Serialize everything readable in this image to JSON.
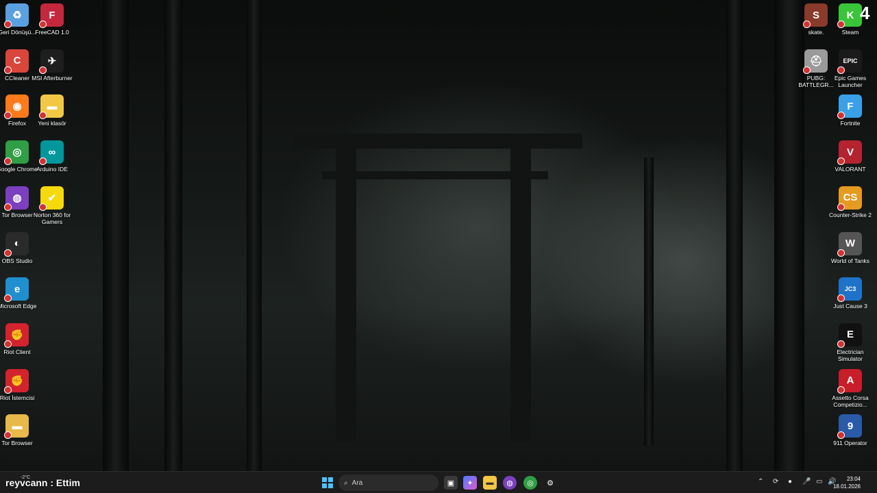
{
  "desktop": {
    "left_col1": [
      {
        "label": "Geri Dönüşü...",
        "icon": "recycle-bin-icon",
        "color": "#5aa0e0",
        "glyph": "♻"
      },
      {
        "label": "CCleaner",
        "icon": "ccleaner-icon",
        "color": "#d9463b",
        "glyph": "C"
      },
      {
        "label": "Firefox",
        "icon": "firefox-icon",
        "color": "#ff7a1a",
        "glyph": "◉"
      },
      {
        "label": "Google Chrome",
        "icon": "chrome-icon",
        "color": "#2f9e44",
        "glyph": "◎"
      },
      {
        "label": "Tor Browser",
        "icon": "tor-icon",
        "color": "#7b3fbf",
        "glyph": "◍"
      },
      {
        "label": "OBS Studio",
        "icon": "obs-icon",
        "color": "#2a2a2a",
        "glyph": "◐"
      },
      {
        "label": "Microsoft Edge",
        "icon": "edge-icon",
        "color": "#1f8fd0",
        "glyph": "e"
      },
      {
        "label": "Riot Client",
        "icon": "riot-client-icon",
        "color": "#d3232e",
        "glyph": "✊"
      },
      {
        "label": "Riot İstemcisi",
        "icon": "riot-client-icon",
        "color": "#d3232e",
        "glyph": "✊"
      },
      {
        "label": "Tor Browser",
        "icon": "folder-icon",
        "color": "#e7b84a",
        "glyph": "▬"
      }
    ],
    "left_col2": [
      {
        "label": "FreeCAD 1.0",
        "icon": "freecad-icon",
        "color": "#c5283d",
        "glyph": "F"
      },
      {
        "label": "MSI Afterburner",
        "icon": "msi-afterburner-icon",
        "color": "#1e1e1e",
        "glyph": "✈"
      },
      {
        "label": "Yeni klasör",
        "icon": "folder-icon",
        "color": "#f2c744",
        "glyph": "▬"
      },
      {
        "label": "Arduino IDE",
        "icon": "arduino-icon",
        "color": "#00979d",
        "glyph": "∞"
      },
      {
        "label": "Norton 360 for Gamers",
        "icon": "norton-icon",
        "color": "#f5d90a",
        "glyph": "✔"
      }
    ],
    "right_col1": [
      {
        "label": "skate.",
        "icon": "skate-icon",
        "color": "#8a3a2a",
        "glyph": "S"
      },
      {
        "label": "PUBG: BATTLEGR...",
        "icon": "pubg-icon",
        "color": "#9a9a9a",
        "glyph": "⛑"
      }
    ],
    "right_col2": [
      {
        "label": "Steam",
        "icon": "steam-icon",
        "color": "#3ac43a",
        "glyph": "K"
      },
      {
        "label": "Epic Games Launcher",
        "icon": "epic-games-icon",
        "color": "#1a1a1a",
        "glyph": "EPIC"
      },
      {
        "label": "Fortnite",
        "icon": "fortnite-icon",
        "color": "#3aa0e8",
        "glyph": "F"
      },
      {
        "label": "VALORANT",
        "icon": "valorant-icon",
        "color": "#b5232f",
        "glyph": "V"
      },
      {
        "label": "Counter-Strike 2",
        "icon": "counter-strike-icon",
        "color": "#e69a1f",
        "glyph": "CS"
      },
      {
        "label": "World of Tanks",
        "icon": "world-of-tanks-icon",
        "color": "#555",
        "glyph": "W"
      },
      {
        "label": "Just Cause 3",
        "icon": "just-cause-icon",
        "color": "#1e73c8",
        "glyph": "JC3"
      },
      {
        "label": "Electrician Simulator",
        "icon": "electrician-simulator-icon",
        "color": "#111",
        "glyph": "E"
      },
      {
        "label": "Assetto Corsa Competizio...",
        "icon": "assetto-corsa-icon",
        "color": "#c81e2a",
        "glyph": "A"
      },
      {
        "label": "911 Operator",
        "icon": "911-operator-icon",
        "color": "#2a5aa8",
        "glyph": "9"
      }
    ],
    "top_right_number": "4"
  },
  "overlay": {
    "username": "reyvcann : Ettim",
    "weather": "-2°C"
  },
  "taskbar": {
    "start_icon": "windows-start-icon",
    "search_placeholder": "Ara",
    "apps": [
      "task-view-icon",
      "copilot-icon",
      "file-explorer-icon",
      "tor-browser-icon",
      "chrome-icon",
      "settings-icon"
    ],
    "time": "23:04",
    "date": "18.01.2026"
  }
}
